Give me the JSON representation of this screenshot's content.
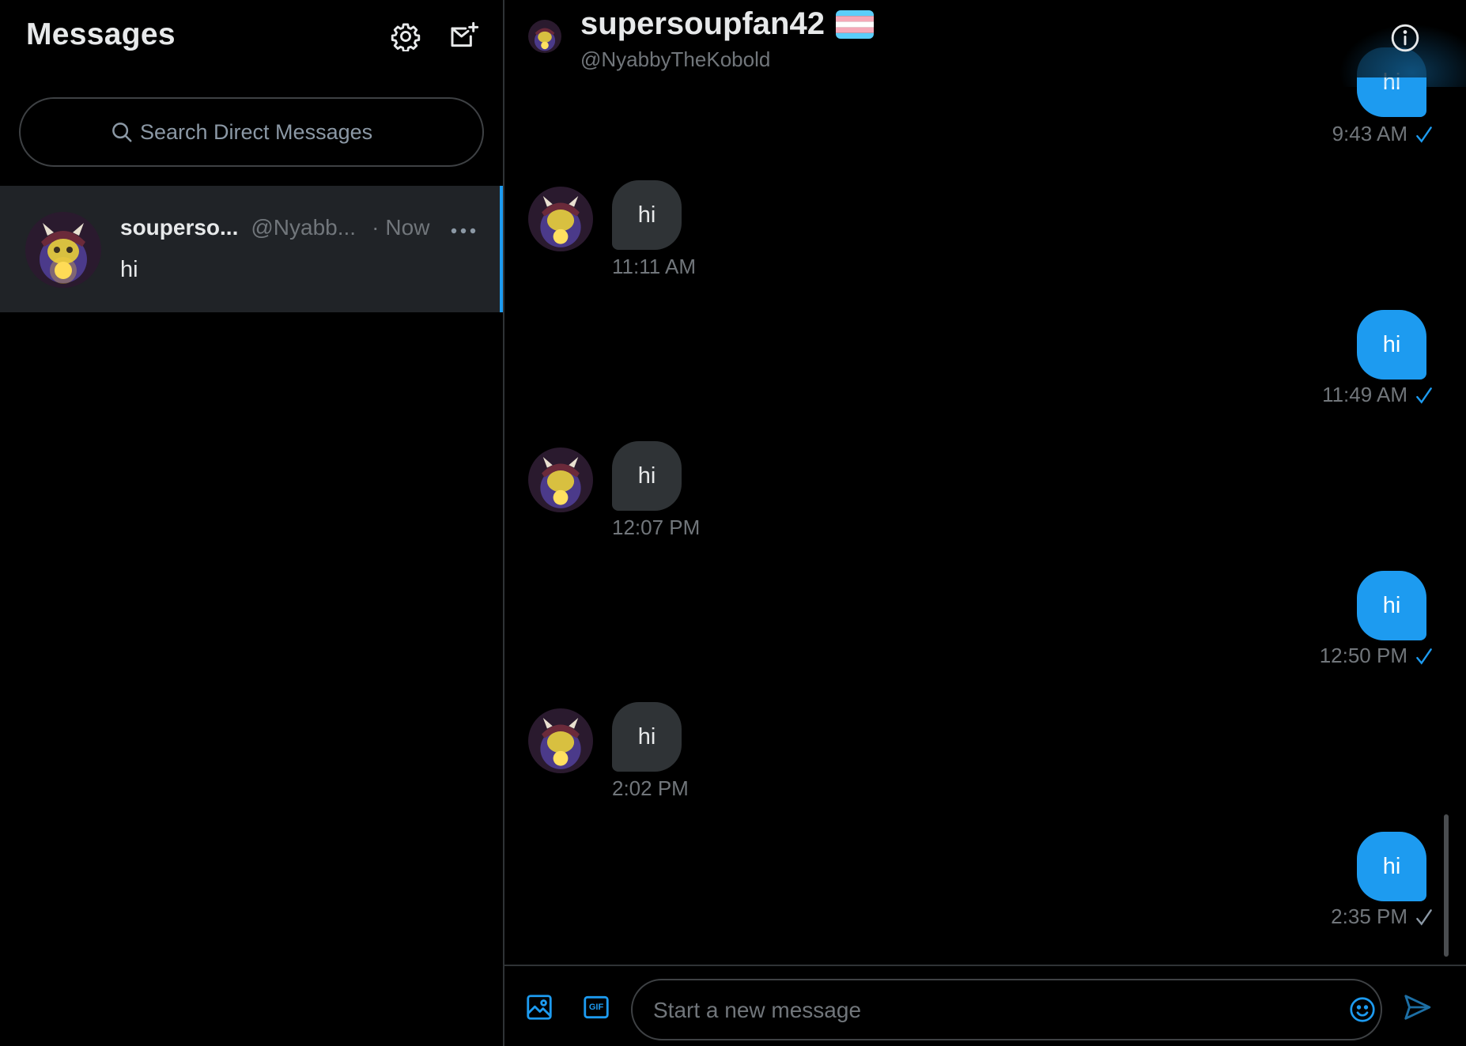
{
  "sidebar": {
    "title": "Messages",
    "search": {
      "placeholder": "Search Direct Messages"
    },
    "conversations": [
      {
        "name": "souperso...",
        "handle": "@Nyabb...",
        "separator": "·",
        "time": "Now",
        "preview": "hi"
      }
    ]
  },
  "chat": {
    "name": "supersoupfan42",
    "handle": "@NyabbyTheKobold",
    "messages": [
      {
        "direction": "sent",
        "text": "hi",
        "time": "9:43 AM",
        "seen": true
      },
      {
        "direction": "received",
        "text": "hi",
        "time": "11:11 AM"
      },
      {
        "direction": "sent",
        "text": "hi",
        "time": "11:49 AM",
        "seen": true
      },
      {
        "direction": "received",
        "text": "hi",
        "time": "12:07 PM"
      },
      {
        "direction": "sent",
        "text": "hi",
        "time": "12:50 PM",
        "seen": true
      },
      {
        "direction": "received",
        "text": "hi",
        "time": "2:02 PM"
      },
      {
        "direction": "sent",
        "text": "hi",
        "time": "2:35 PM",
        "seen": false
      }
    ],
    "composer": {
      "placeholder": "Start a new message",
      "gif_label": "GIF"
    }
  },
  "colors": {
    "accent": "#1d9bf0",
    "background": "#000000",
    "received_bubble": "#2f3336",
    "muted_text": "#71767b",
    "flag_blue": "#5bcefa",
    "flag_pink": "#f5a9b8",
    "flag_white": "#ffffff"
  },
  "icons": {
    "settings": "gear-icon",
    "compose": "new-message-icon",
    "search": "search-icon",
    "more": "more-icon",
    "info": "info-icon",
    "media": "image-icon",
    "gif": "gif-icon",
    "emoji": "emoji-icon",
    "send": "send-icon",
    "seen": "checkmark-icon"
  }
}
